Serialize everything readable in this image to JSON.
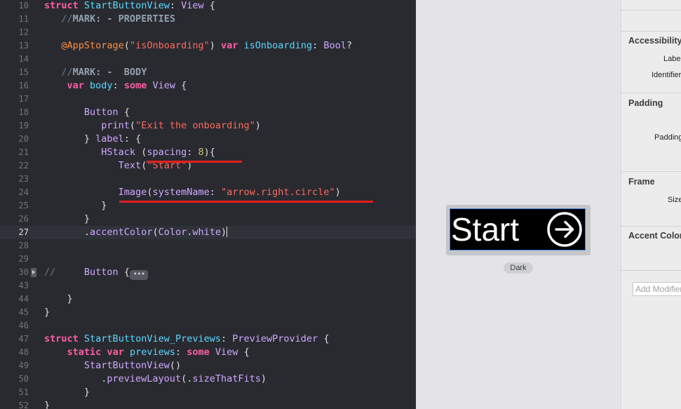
{
  "editor": {
    "current_line": "27",
    "lines": [
      {
        "n": "10",
        "t": [
          [
            "kw",
            "struct"
          ],
          [
            "pl",
            " "
          ],
          [
            "ty",
            "StartButtonView"
          ],
          [
            "pl",
            ": "
          ],
          [
            "sys",
            "View"
          ],
          [
            "pl",
            " {"
          ]
        ]
      },
      {
        "n": "11",
        "t": [
          [
            "pl",
            "   "
          ],
          [
            "cm",
            "//"
          ],
          [
            "mk",
            "MARK: - PROPERTIES"
          ]
        ]
      },
      {
        "n": "12",
        "t": []
      },
      {
        "n": "13",
        "t": [
          [
            "pl",
            "   "
          ],
          [
            "attr",
            "@AppStorage"
          ],
          [
            "pl",
            "("
          ],
          [
            "st",
            "\"isOnboarding\""
          ],
          [
            "pl",
            ") "
          ],
          [
            "kw",
            "var"
          ],
          [
            "pl",
            " "
          ],
          [
            "ty",
            "isOnboarding"
          ],
          [
            "pl",
            ": "
          ],
          [
            "sys",
            "Bool"
          ],
          [
            "pl",
            "?"
          ]
        ]
      },
      {
        "n": "14",
        "t": []
      },
      {
        "n": "15",
        "t": [
          [
            "pl",
            "   "
          ],
          [
            "cm",
            "//"
          ],
          [
            "mk",
            "MARK: -  BODY"
          ]
        ]
      },
      {
        "n": "16",
        "t": [
          [
            "pl",
            "    "
          ],
          [
            "kw",
            "var"
          ],
          [
            "pl",
            " "
          ],
          [
            "ty",
            "body"
          ],
          [
            "pl",
            ": "
          ],
          [
            "kw",
            "some"
          ],
          [
            "pl",
            " "
          ],
          [
            "sys",
            "View"
          ],
          [
            "pl",
            " {"
          ]
        ]
      },
      {
        "n": "17",
        "t": []
      },
      {
        "n": "18",
        "t": [
          [
            "pl",
            "       "
          ],
          [
            "sys",
            "Button"
          ],
          [
            "pl",
            " {"
          ]
        ]
      },
      {
        "n": "19",
        "t": [
          [
            "pl",
            "          "
          ],
          [
            "sys",
            "print"
          ],
          [
            "pl",
            "("
          ],
          [
            "st",
            "\"Exit the onboarding\""
          ],
          [
            "pl",
            ")"
          ]
        ]
      },
      {
        "n": "20",
        "t": [
          [
            "pl",
            "       } "
          ],
          [
            "sys",
            "label"
          ],
          [
            "pl",
            ": {"
          ]
        ]
      },
      {
        "n": "21",
        "t": [
          [
            "pl",
            "          "
          ],
          [
            "sys",
            "HStack"
          ],
          [
            "pl",
            " ("
          ],
          [
            "sys",
            "spacing"
          ],
          [
            "pl",
            ": "
          ],
          [
            "num",
            "8"
          ],
          [
            "pl",
            "){"
          ]
        ]
      },
      {
        "n": "22",
        "t": [
          [
            "pl",
            "             "
          ],
          [
            "sys",
            "Text"
          ],
          [
            "pl",
            "("
          ],
          [
            "st",
            "\"Start\""
          ],
          [
            "pl",
            ")"
          ]
        ]
      },
      {
        "n": "23",
        "t": []
      },
      {
        "n": "24",
        "t": [
          [
            "pl",
            "             "
          ],
          [
            "sys",
            "Image"
          ],
          [
            "pl",
            "("
          ],
          [
            "sys",
            "systemName"
          ],
          [
            "pl",
            ": "
          ],
          [
            "st",
            "\"arrow.right.circle\""
          ],
          [
            "pl",
            ")"
          ]
        ]
      },
      {
        "n": "25",
        "t": [
          [
            "pl",
            "          }"
          ]
        ]
      },
      {
        "n": "26",
        "t": [
          [
            "pl",
            "       }"
          ]
        ]
      },
      {
        "n": "27",
        "t": [
          [
            "pl",
            "       ."
          ],
          [
            "sys",
            "accentColor"
          ],
          [
            "pl",
            "("
          ],
          [
            "sys",
            "Color"
          ],
          [
            "pl",
            "."
          ],
          [
            "sys",
            "white"
          ],
          [
            "pl",
            ")"
          ]
        ]
      },
      {
        "n": "28",
        "t": []
      },
      {
        "n": "29",
        "t": []
      },
      {
        "n": "30",
        "t": [
          [
            "cm",
            "//     "
          ],
          [
            "sys",
            "Button"
          ],
          [
            "pl",
            " {"
          ]
        ]
      },
      {
        "n": "43",
        "t": []
      },
      {
        "n": "44",
        "t": [
          [
            "pl",
            "    }"
          ]
        ]
      },
      {
        "n": "45",
        "t": [
          [
            "pl",
            "}"
          ]
        ]
      },
      {
        "n": "46",
        "t": []
      },
      {
        "n": "47",
        "t": [
          [
            "kw",
            "struct"
          ],
          [
            "pl",
            " "
          ],
          [
            "ty",
            "StartButtonView_Previews"
          ],
          [
            "pl",
            ": "
          ],
          [
            "sys",
            "PreviewProvider"
          ],
          [
            "pl",
            " {"
          ]
        ]
      },
      {
        "n": "48",
        "t": [
          [
            "pl",
            "    "
          ],
          [
            "kw",
            "static"
          ],
          [
            "pl",
            " "
          ],
          [
            "kw",
            "var"
          ],
          [
            "pl",
            " "
          ],
          [
            "ty",
            "previews"
          ],
          [
            "pl",
            ": "
          ],
          [
            "kw",
            "some"
          ],
          [
            "pl",
            " "
          ],
          [
            "sys",
            "View"
          ],
          [
            "pl",
            " {"
          ]
        ]
      },
      {
        "n": "49",
        "t": [
          [
            "pl",
            "       "
          ],
          [
            "sys",
            "StartButtonView"
          ],
          [
            "pl",
            "()"
          ]
        ]
      },
      {
        "n": "50",
        "t": [
          [
            "pl",
            "          ."
          ],
          [
            "sys",
            "previewLayout"
          ],
          [
            "pl",
            "(."
          ],
          [
            "sys",
            "sizeThatFits"
          ],
          [
            "pl",
            ")"
          ]
        ]
      },
      {
        "n": "51",
        "t": [
          [
            "pl",
            "       }"
          ]
        ]
      },
      {
        "n": "52",
        "t": [
          [
            "pl",
            "}"
          ]
        ]
      }
    ],
    "fold_pill": "•••"
  },
  "preview": {
    "button_text": "Start",
    "icon": "arrow-right-circle-icon",
    "scheme_label": "Dark"
  },
  "inspector": {
    "accessibility": {
      "title": "Accessibility",
      "label": "Label",
      "identifier": "Identifier"
    },
    "padding": {
      "title": "Padding",
      "padding": "Padding"
    },
    "frame": {
      "title": "Frame",
      "size": "Size"
    },
    "accent": {
      "title": "Accent Color"
    },
    "add_modifier_placeholder": "Add Modifier"
  },
  "colors": {
    "editor_bg": "#292a30",
    "keyword": "#fc5fa3",
    "type": "#5dd8ff",
    "system": "#d0a8ff",
    "string": "#fc6a5d",
    "annotation": "#e52020"
  }
}
